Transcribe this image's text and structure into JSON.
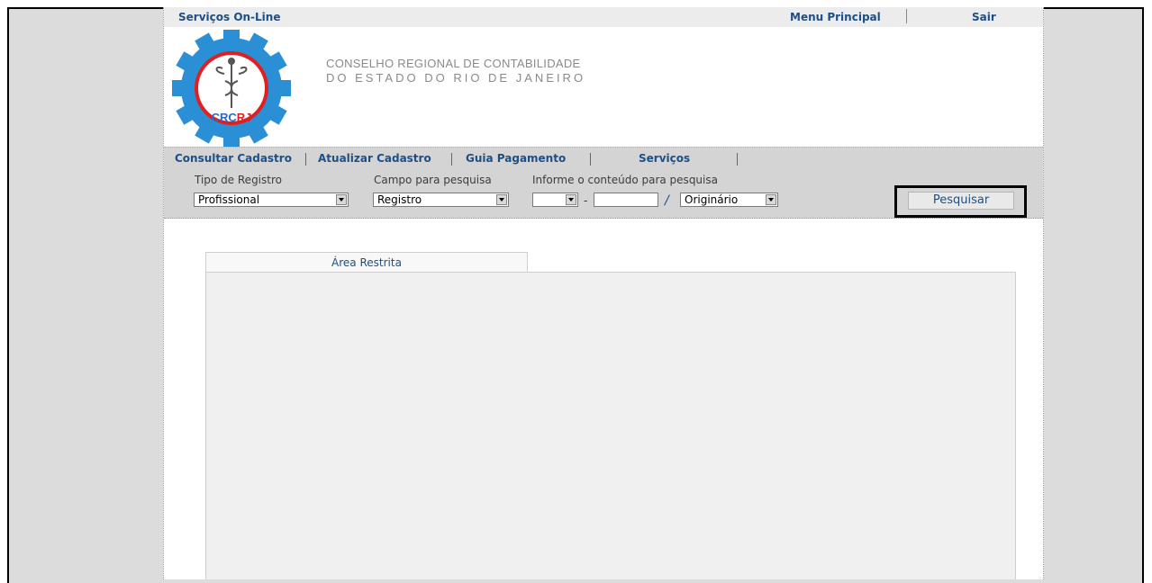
{
  "topbar": {
    "services_online": "Serviços On-Line",
    "main_menu": "Menu Principal",
    "logout": "Sair"
  },
  "logo": {
    "text": "CRCRJ"
  },
  "org": {
    "line1": "CONSELHO REGIONAL DE CONTABILIDADE",
    "line2": "DO ESTADO DO RIO DE JANEIRO"
  },
  "nav": {
    "items": [
      {
        "label": "Consultar Cadastro"
      },
      {
        "label": "Atualizar Cadastro"
      },
      {
        "label": "Guia Pagamento"
      },
      {
        "label": "Serviços"
      }
    ]
  },
  "search": {
    "registry_type_label": "Tipo de Registro",
    "registry_type_value": "Profissional",
    "field_label": "Campo para pesquisa",
    "field_value": "Registro",
    "content_label": "Informe o conteúdo para pesquisa",
    "uf_value": "",
    "number_value": "",
    "dash": "-",
    "slash": "/",
    "origin_value": "Originário",
    "submit_label": "Pesquisar"
  },
  "restricted": {
    "tab_label": "Área Restrita"
  },
  "colors": {
    "link": "#1d4f86",
    "logo_gear": "#2b8fd6",
    "logo_red": "#e02020"
  }
}
